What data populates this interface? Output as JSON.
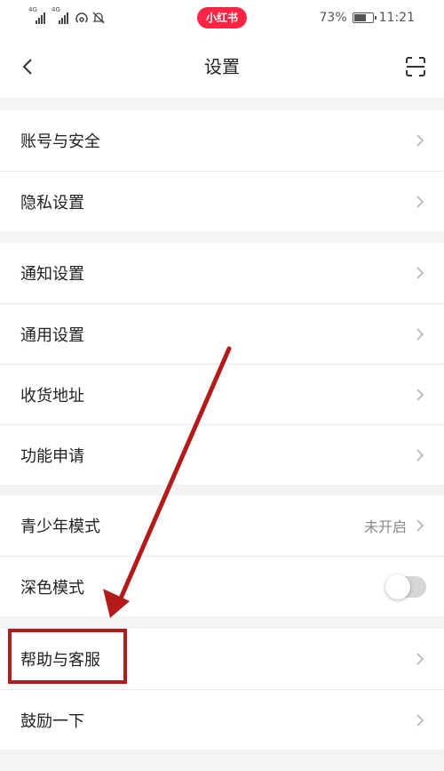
{
  "status_bar": {
    "network1": "4G",
    "network2": "4G",
    "app_badge": "小红书",
    "battery_text": "73%",
    "battery_level": 0.73,
    "time": "11:21"
  },
  "nav": {
    "title": "设置"
  },
  "groups": [
    {
      "items": [
        {
          "label": "账号与安全"
        },
        {
          "label": "隐私设置"
        }
      ]
    },
    {
      "items": [
        {
          "label": "通知设置"
        },
        {
          "label": "通用设置"
        },
        {
          "label": "收货地址"
        },
        {
          "label": "功能申请"
        }
      ]
    },
    {
      "items": [
        {
          "label": "青少年模式",
          "value": "未开启"
        },
        {
          "label": "深色模式",
          "toggle": false
        }
      ]
    },
    {
      "items": [
        {
          "label": "帮助与客服"
        },
        {
          "label": "鼓励一下"
        }
      ]
    }
  ],
  "colors": {
    "brand": "#ff2442",
    "annotation": "#b31b1b",
    "background": "#f4f4f4"
  },
  "icons": {
    "back": "chevron-left-icon",
    "scan": "scan-icon",
    "row_arrow": "chevron-right-icon"
  }
}
